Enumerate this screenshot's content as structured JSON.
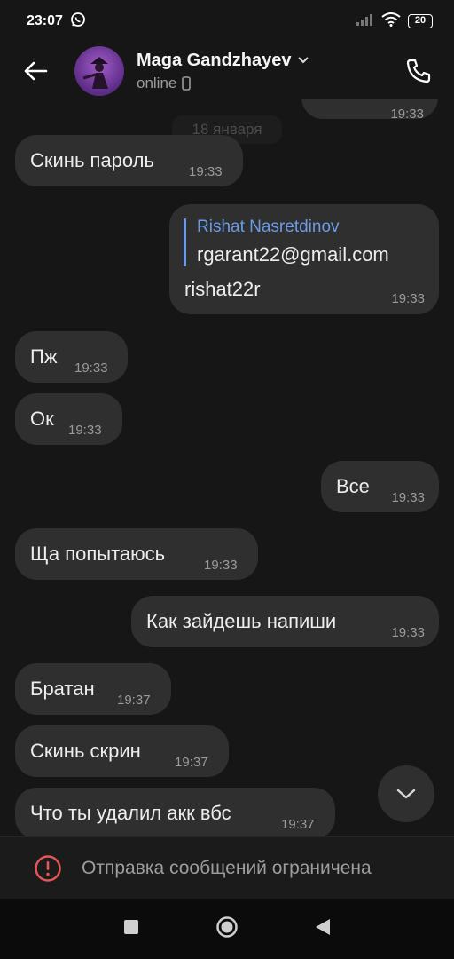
{
  "status_bar": {
    "time": "23:07",
    "battery": "20"
  },
  "header": {
    "name": "Maga Gandzhayev",
    "status": "online"
  },
  "date_chip": "18 января",
  "messages": [
    {
      "text": "Скинь пароль",
      "time": "19:33"
    },
    {
      "reply_author": "Rishat Nasretdinov",
      "reply_text": "rgarant22@gmail.com",
      "text": "rishat22r",
      "time": "19:33"
    },
    {
      "text": "Пж",
      "time": "19:33"
    },
    {
      "text": "Ок",
      "time": "19:33"
    },
    {
      "text": "Все",
      "time": "19:33"
    },
    {
      "text": "Ща попытаюсь",
      "time": "19:33"
    },
    {
      "text": "Как зайдешь напиши",
      "time": "19:33"
    },
    {
      "text": "Братан",
      "time": "19:37"
    },
    {
      "text": "Скинь скрин",
      "time": "19:37"
    },
    {
      "text": "Что ты удалил акк вбс",
      "time": "19:37"
    }
  ],
  "partial_top_time": "19:33",
  "restriction": "Отправка сообщений ограничена",
  "colors": {
    "accent": "#6b9be6",
    "warning": "#e55656",
    "bubble": "#2f2f2f",
    "background": "#161616"
  },
  "icons": [
    "whatsapp-icon",
    "signal-icon",
    "wifi-icon",
    "back-arrow-icon",
    "chevron-down-icon",
    "phone-icon",
    "scroll-down-icon",
    "alert-icon",
    "square-nav-icon",
    "circle-nav-icon",
    "triangle-nav-icon"
  ]
}
